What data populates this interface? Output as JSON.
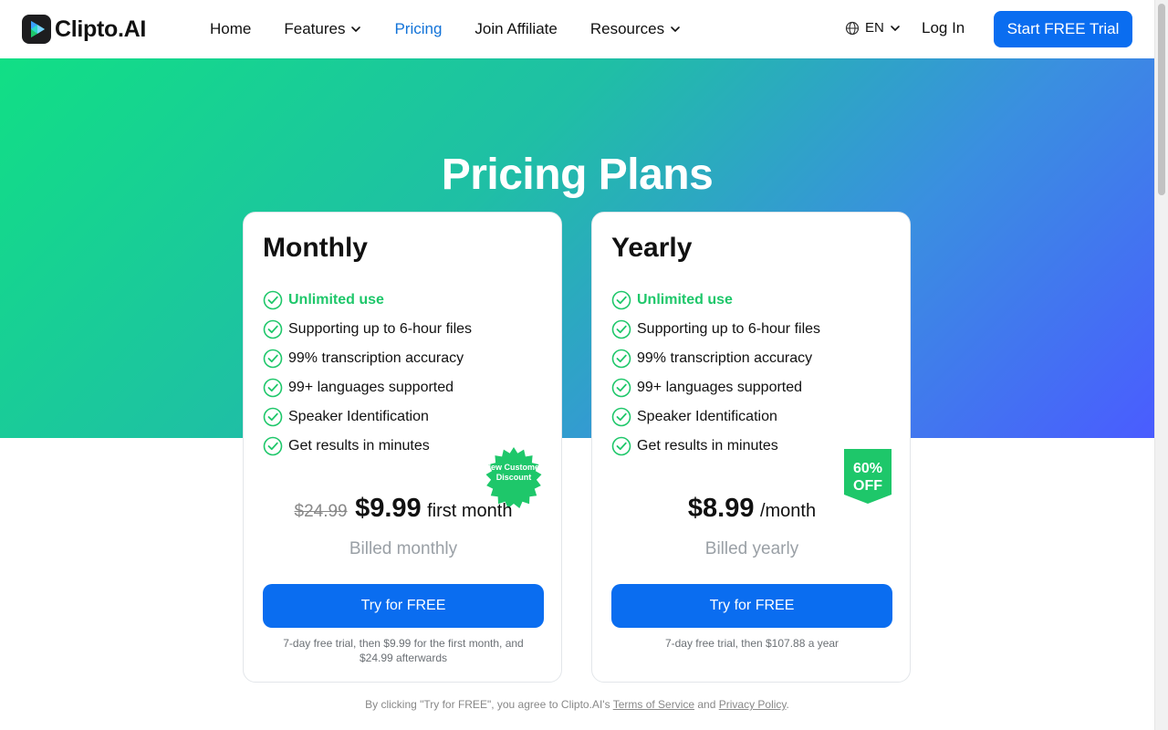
{
  "brand": {
    "name": "Clipto.AI"
  },
  "nav": {
    "items": [
      {
        "label": "Home",
        "dropdown": false,
        "active": false
      },
      {
        "label": "Features",
        "dropdown": true,
        "active": false
      },
      {
        "label": "Pricing",
        "dropdown": false,
        "active": true
      },
      {
        "label": "Join Affiliate",
        "dropdown": false,
        "active": false
      },
      {
        "label": "Resources",
        "dropdown": true,
        "active": false
      }
    ],
    "language": "EN",
    "login": "Log In",
    "cta": "Start FREE Trial"
  },
  "hero": {
    "title": "Pricing Plans"
  },
  "colors": {
    "accent": "#0a6df0",
    "green": "#1ec76a",
    "active_nav": "#1273d8"
  },
  "plans": {
    "monthly": {
      "title": "Monthly",
      "features": [
        "Unlimited use",
        "Supporting up to 6-hour files",
        "99% transcription accuracy",
        "99+ languages supported",
        "Speaker Identification",
        "Get results in minutes"
      ],
      "old_price": "$24.99",
      "price": "$9.99",
      "price_suffix": "first month",
      "billed": "Billed monthly",
      "button": "Try for FREE",
      "fine_print": "7-day free trial, then $9.99 for the first month, and $24.99 afterwards",
      "badge": "New Customer Discount"
    },
    "yearly": {
      "title": "Yearly",
      "features": [
        "Unlimited use",
        "Supporting up to 6-hour files",
        "99% transcription accuracy",
        "99+ languages supported",
        "Speaker Identification",
        "Get results in minutes"
      ],
      "price": "$8.99",
      "price_suffix": "/month",
      "billed": "Billed yearly",
      "button": "Try for FREE",
      "fine_print": "7-day free trial, then $107.88 a year",
      "badge_line1": "60%",
      "badge_line2": "OFF"
    }
  },
  "terms": {
    "prefix": "By clicking \"Try for FREE\", you agree to Clipto.AI's ",
    "tos": "Terms of Service",
    "and": " and ",
    "privacy": "Privacy Policy",
    "suffix": "."
  }
}
